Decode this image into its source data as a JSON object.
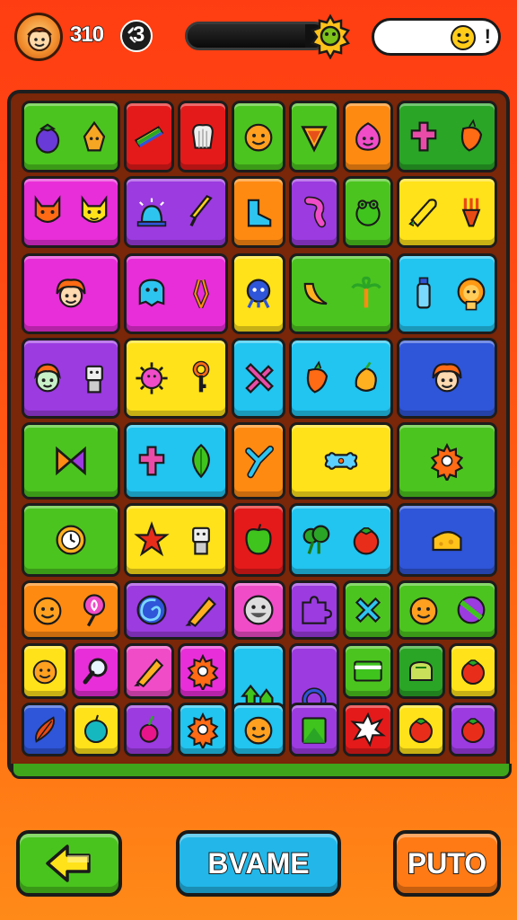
{
  "hud": {
    "score": "310",
    "moves": "3",
    "progress": 0.85,
    "status_mark": "!"
  },
  "buttons": {
    "back_icon": "arrow-left-icon",
    "middle_label": "BVAME",
    "right_label": "PUTO"
  },
  "colors": {
    "green": "#4cc41f",
    "red": "#e41a1a",
    "orange": "#ff8a12",
    "magenta": "#e82ed8",
    "purple": "#9b3be0",
    "yellow": "#ffe21a",
    "cyan": "#22c4f0",
    "blue": "#2f55d8",
    "pink": "#f04cc8",
    "darkgreen": "#2aa526"
  },
  "board": {
    "tiles": [
      {
        "color": "green",
        "icons": [
          "eggplant-icon",
          "sweet-potato-icon"
        ]
      },
      {
        "color": "red",
        "icons": [
          "rainbow-block-icon"
        ]
      },
      {
        "color": "red",
        "icons": [
          "chef-hat-icon"
        ]
      },
      {
        "color": "green",
        "icons": [
          "orange-face-icon"
        ]
      },
      {
        "color": "green",
        "icons": [
          "heart-shield-icon"
        ]
      },
      {
        "color": "orange",
        "icons": [
          "onion-face-icon"
        ]
      },
      {
        "color": "darkgreen",
        "icons": [
          "cross-icon",
          "carrot-icon"
        ]
      },
      {
        "color": "magenta",
        "icons": [
          "fox-face-icon",
          "cat-face-icon"
        ]
      },
      {
        "color": "purple",
        "icons": [
          "alarm-bell-icon",
          "knife-icon"
        ]
      },
      {
        "color": "orange",
        "icons": [
          "boot-icon"
        ]
      },
      {
        "color": "purple",
        "icons": [
          "worm-icon"
        ]
      },
      {
        "color": "green",
        "icons": [
          "frog-icon"
        ]
      },
      {
        "color": "yellow",
        "icons": [
          "corn-icon",
          "fork-icon"
        ]
      },
      {
        "color": "magenta",
        "icons": [
          "girl-face-icon"
        ]
      },
      {
        "color": "magenta",
        "icons": [
          "blue-creature-icon",
          "pliers-icon"
        ]
      },
      {
        "color": "yellow",
        "icons": [
          "alien-face-icon"
        ]
      },
      {
        "color": "green",
        "icons": [
          "banana-icon",
          "palm-tree-icon"
        ]
      },
      {
        "color": "cyan",
        "icons": [
          "bottle-icon",
          "lion-icon"
        ]
      },
      {
        "color": "purple",
        "icons": [
          "boy-face-icon",
          "robot-icon"
        ]
      },
      {
        "color": "yellow",
        "icons": [
          "virus-icon",
          "key-icon"
        ]
      },
      {
        "color": "cyan",
        "icons": [
          "bandage-icon"
        ]
      },
      {
        "color": "cyan",
        "icons": [
          "carrot-icon",
          "mango-icon"
        ]
      },
      {
        "color": "blue",
        "icons": [
          "girl-face-icon"
        ]
      },
      {
        "color": "green",
        "icons": [
          "bow-icon"
        ]
      },
      {
        "color": "cyan",
        "icons": [
          "cross-icon",
          "leaf-icon"
        ]
      },
      {
        "color": "orange",
        "icons": [
          "hammer-icon"
        ]
      },
      {
        "color": "yellow",
        "icons": [
          "bone-icon"
        ]
      },
      {
        "color": "green",
        "icons": [
          "gear-icon"
        ]
      },
      {
        "color": "green",
        "icons": [
          "clock-icon"
        ]
      },
      {
        "color": "yellow",
        "icons": [
          "star-icon",
          "robot-icon"
        ]
      },
      {
        "color": "red",
        "icons": [
          "green-apple-icon"
        ]
      },
      {
        "color": "cyan",
        "icons": [
          "broccoli-icon",
          "tomato-icon"
        ]
      },
      {
        "color": "blue",
        "icons": [
          "cheese-icon"
        ]
      },
      {
        "color": "orange",
        "icons": [
          "orange-face-icon",
          "lollipop-icon"
        ]
      },
      {
        "color": "purple",
        "icons": [
          "spiral-icon",
          "crayon-icon"
        ]
      },
      {
        "color": "pink",
        "icons": [
          "smiley-icon"
        ]
      },
      {
        "color": "purple",
        "icons": [
          "puzzle-icon"
        ]
      },
      {
        "color": "green",
        "icons": [
          "x-mark-icon"
        ]
      },
      {
        "color": "green",
        "icons": [
          "orange-face-icon",
          "ball-icon"
        ]
      },
      {
        "color": "yellow",
        "icons": [
          "orange-face-icon"
        ]
      },
      {
        "color": "magenta",
        "icons": [
          "magnifier-icon"
        ]
      },
      {
        "color": "pink",
        "icons": [
          "crayon-icon"
        ]
      },
      {
        "color": "magenta",
        "icons": [
          "gear-icon"
        ]
      },
      {
        "color": "cyan",
        "icons": [
          "arrows-icon"
        ]
      },
      {
        "color": "purple",
        "icons": [
          "ring-icon"
        ]
      },
      {
        "color": "green",
        "icons": [
          "card-icon"
        ]
      },
      {
        "color": "darkgreen",
        "icons": [
          "bread-icon"
        ]
      },
      {
        "color": "yellow",
        "icons": [
          "tomato-icon"
        ]
      },
      {
        "color": "blue",
        "icons": [
          "feather-icon"
        ]
      },
      {
        "color": "yellow",
        "icons": [
          "teal-apple-icon"
        ]
      },
      {
        "color": "purple",
        "icons": [
          "cherry-icon"
        ]
      },
      {
        "color": "cyan",
        "icons": [
          "gear-icon"
        ]
      },
      {
        "color": "cyan",
        "icons": [
          "orange-face-icon"
        ]
      },
      {
        "color": "purple",
        "icons": [
          "leaf-card-icon"
        ]
      },
      {
        "color": "red",
        "icons": [
          "star-burst-icon"
        ]
      },
      {
        "color": "yellow",
        "icons": [
          "tomato-icon"
        ]
      },
      {
        "color": "purple",
        "icons": [
          "tomato-icon"
        ]
      }
    ]
  }
}
